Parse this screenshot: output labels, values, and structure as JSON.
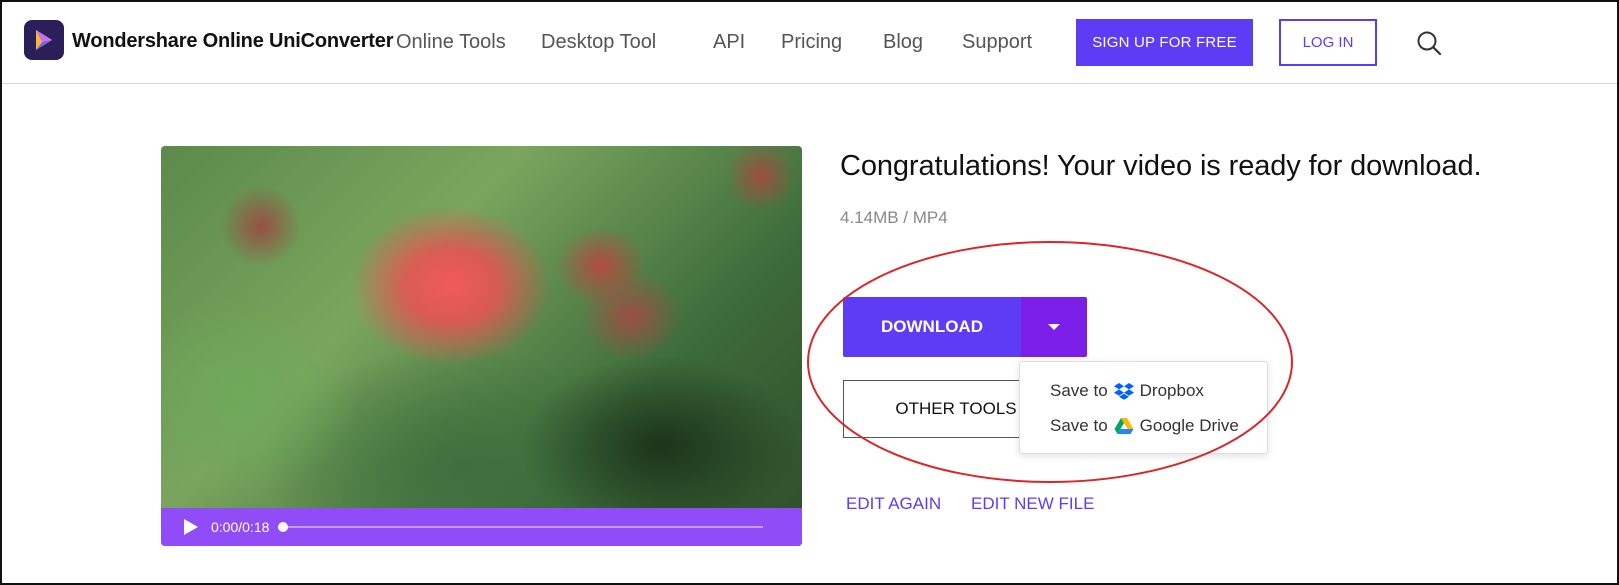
{
  "header": {
    "brand": "Wondershare Online UniConverter",
    "nav": [
      "Online Tools",
      "Desktop Tool",
      "API",
      "Pricing",
      "Blog",
      "Support"
    ],
    "signup_label": "SIGN UP FOR FREE",
    "login_label": "LOG IN",
    "icons": {
      "logo": "uniconverter-logo-icon",
      "search": "search-icon"
    }
  },
  "player": {
    "time": "0:00/0:18",
    "progress": 0,
    "icons": {
      "play": "play-icon"
    }
  },
  "result": {
    "title": "Congratulations! Your video is ready for download.",
    "meta": "4.14MB / MP4",
    "download_label": "DOWNLOAD",
    "other_tools_label": "OTHER TOOLS",
    "edit_again_label": "EDIT AGAIN",
    "edit_new_label": "EDIT NEW FILE"
  },
  "dropdown": {
    "items": [
      {
        "prefix": "Save to",
        "service": "Dropbox",
        "icon": "dropbox-icon"
      },
      {
        "prefix": "Save to",
        "service": "Google Drive",
        "icon": "google-drive-icon"
      }
    ]
  },
  "colors": {
    "accent": "#5c3df5",
    "accent_dark": "#7b1fe8",
    "player_bar": "#8f4cf7",
    "annotation": "#d9262b"
  }
}
